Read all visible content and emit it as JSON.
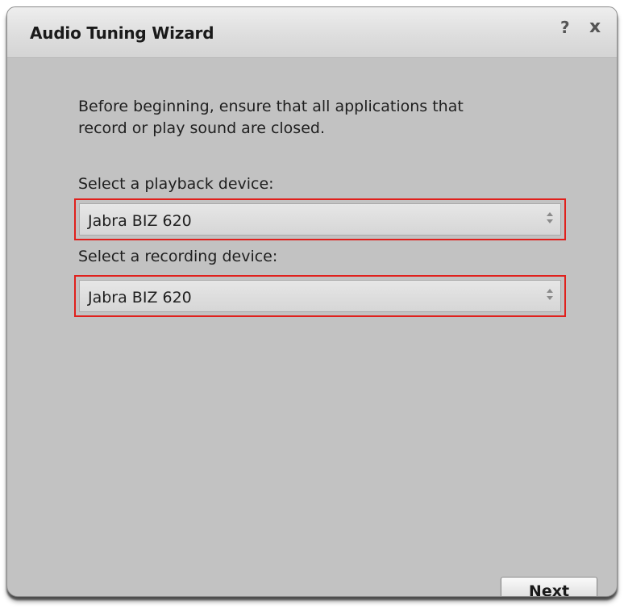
{
  "window": {
    "title": "Audio Tuning Wizard",
    "help_glyph": "?",
    "close_glyph": "x"
  },
  "main": {
    "instructions": "Before beginning, ensure that all applications that\nrecord or play sound are closed.",
    "playback": {
      "label": "Select a playback device:",
      "value": "Jabra BIZ 620"
    },
    "recording": {
      "label": "Select a recording device:",
      "value": "Jabra BIZ 620"
    }
  },
  "footer": {
    "next_label": "Next"
  },
  "colors": {
    "highlight_border": "#e0201c",
    "window_background": "#c2c2c2"
  },
  "icons": {
    "dropdown": "updown-arrow-icon",
    "help": "help-icon",
    "close": "close-icon"
  }
}
